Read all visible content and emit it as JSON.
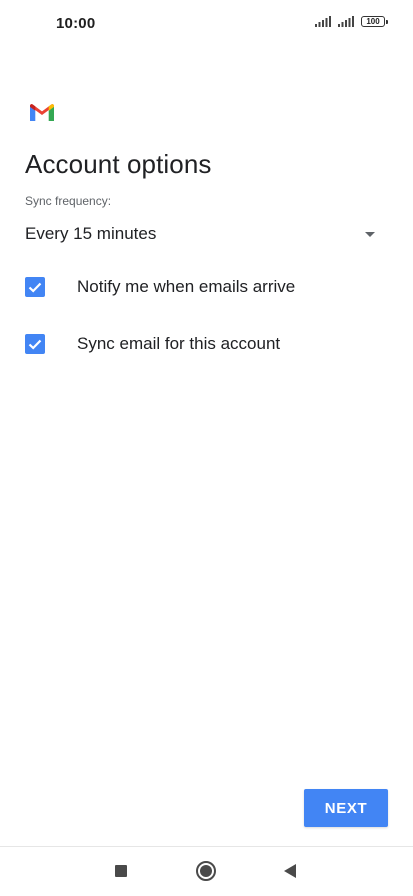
{
  "status_bar": {
    "time": "10:00",
    "battery": "100",
    "icons": [
      "signal-icon",
      "signal-icon",
      "battery-icon"
    ]
  },
  "app": {
    "logo": "gmail-logo"
  },
  "page": {
    "title": "Account options"
  },
  "sync": {
    "label": "Sync frequency:",
    "selected": "Every 15 minutes"
  },
  "options": {
    "notify": {
      "label": "Notify me when emails arrive",
      "checked": true
    },
    "sync_email": {
      "label": "Sync email for this account",
      "checked": true
    }
  },
  "actions": {
    "next_label": "NEXT"
  },
  "navigation": {
    "buttons": [
      "recents",
      "home",
      "back"
    ]
  },
  "colors": {
    "accent": "#4285f4",
    "text": "#202124",
    "secondary_text": "#5f6368"
  }
}
